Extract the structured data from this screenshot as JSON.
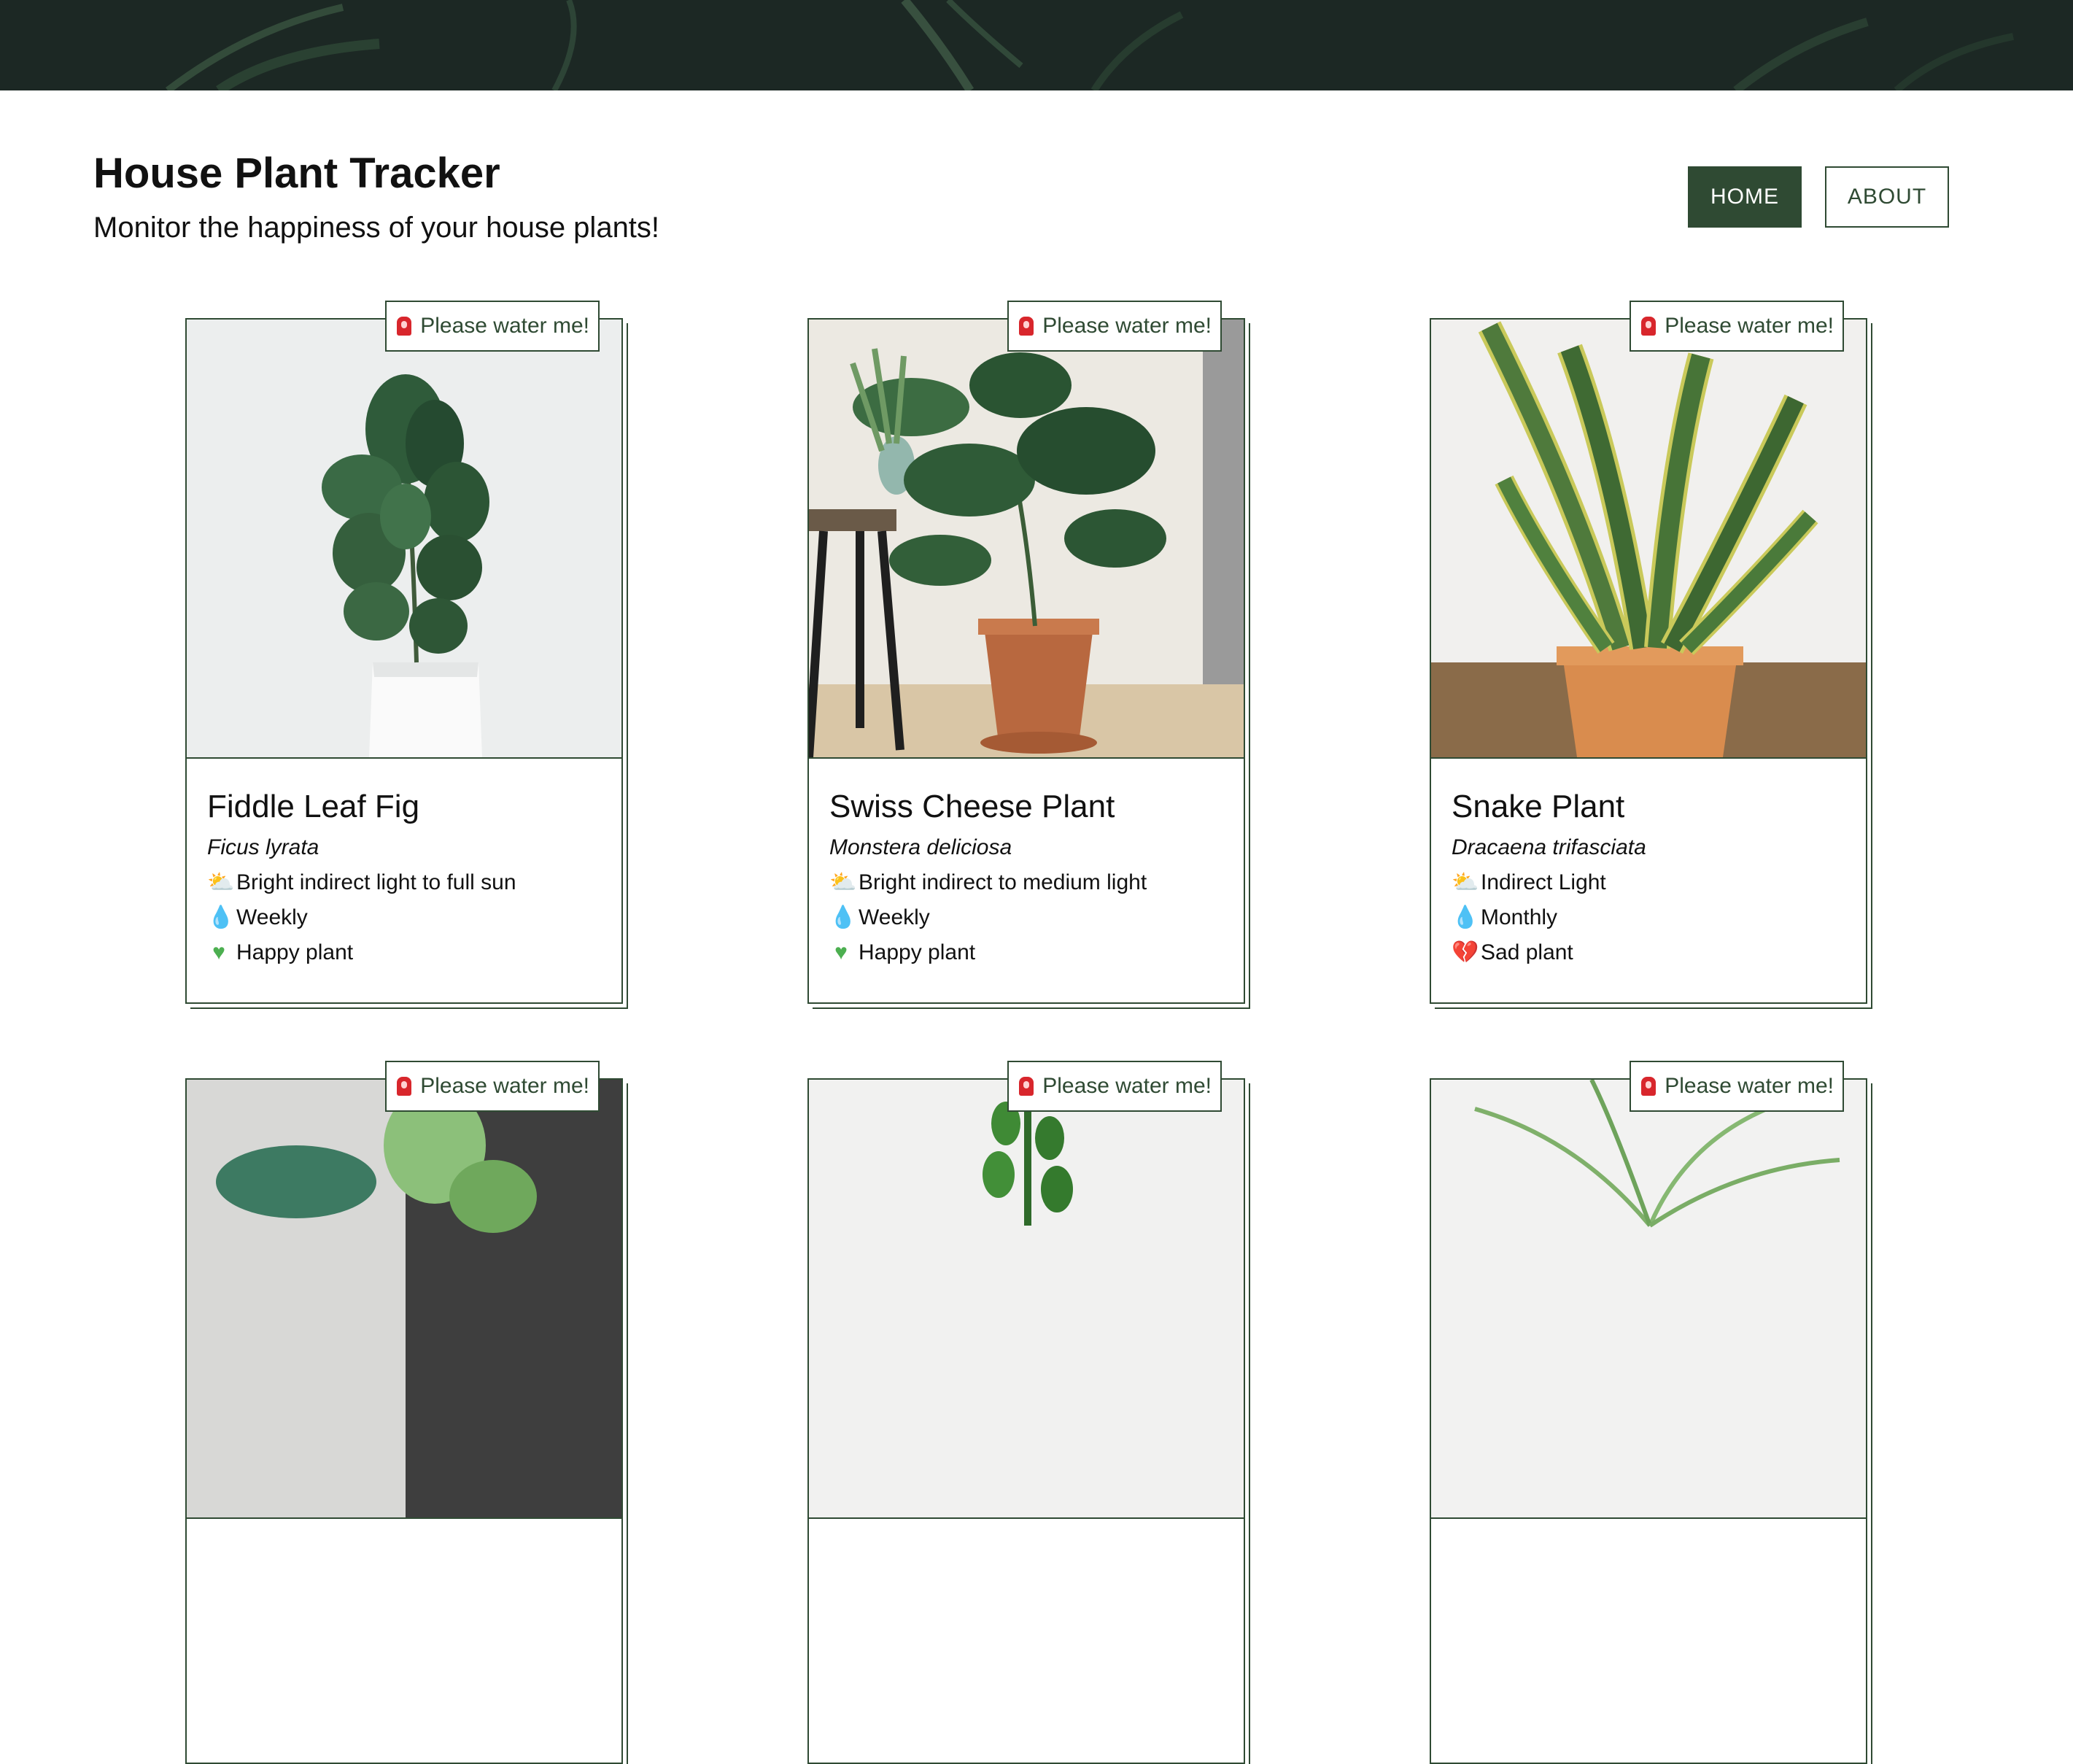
{
  "header": {
    "title": "House Plant Tracker",
    "subtitle": "Monitor the happiness of your house plants!"
  },
  "nav": {
    "home_label": "HOME",
    "about_label": "ABOUT"
  },
  "colors": {
    "accent": "#2f4a33",
    "hero": "#1d2a24",
    "alert_icon": "#d8262c"
  },
  "plants": [
    {
      "badge": "Please water me!",
      "name": "Fiddle Leaf Fig",
      "scientific": "Ficus lyrata",
      "light": "Bright indirect light to full sun",
      "water": "Weekly",
      "mood": "Happy plant",
      "light_icon": "sun-behind-cloud-icon",
      "water_icon": "droplet-icon",
      "mood_icon": "green-heart-icon"
    },
    {
      "badge": "Please water me!",
      "name": "Swiss Cheese Plant",
      "scientific": "Monstera deliciosa",
      "light": "Bright indirect to medium light",
      "water": "Weekly",
      "mood": "Happy plant",
      "light_icon": "sun-behind-cloud-icon",
      "water_icon": "droplet-icon",
      "mood_icon": "green-heart-icon"
    },
    {
      "badge": "Please water me!",
      "name": "Snake Plant",
      "scientific": "Dracaena trifasciata",
      "light": "Indirect Light",
      "water": "Monthly",
      "mood": "Sad plant",
      "light_icon": "sun-behind-cloud-icon",
      "water_icon": "droplet-icon",
      "mood_icon": "broken-heart-icon"
    },
    {
      "badge": "Please water me!"
    },
    {
      "badge": "Please water me!"
    },
    {
      "badge": "Please water me!"
    }
  ]
}
